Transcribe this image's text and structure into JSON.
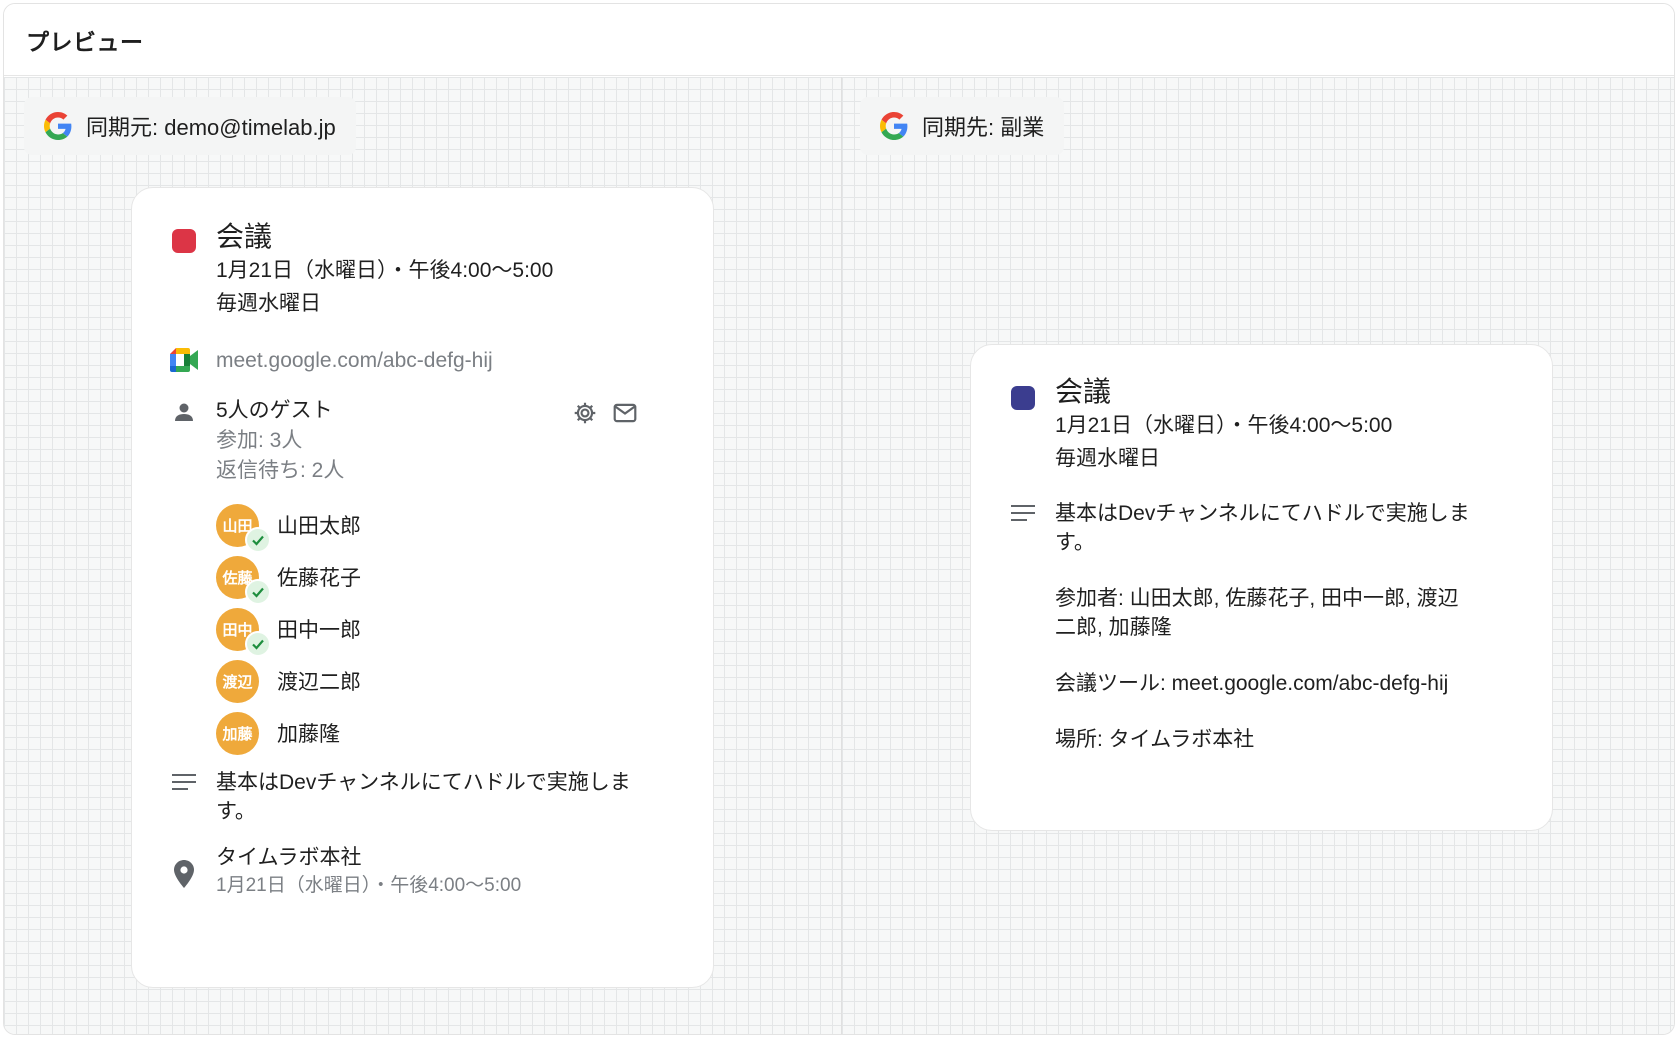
{
  "header": {
    "title": "プレビュー"
  },
  "left": {
    "chip": "同期元: demo@timelab.jp",
    "event": {
      "title": "会議",
      "color": "#dc3546",
      "datetime": "1月21日（水曜日）・午後4:00〜5:00",
      "recurrence": "毎週水曜日",
      "meet_link": "meet.google.com/abc-defg-hij",
      "guests_title": "5人のゲスト",
      "guests_joined": "参加: 3人",
      "guests_pending": "返信待ち: 2人",
      "guests": [
        {
          "initials": "山田",
          "name": "山田太郎",
          "accepted": true
        },
        {
          "initials": "佐藤",
          "name": "佐藤花子",
          "accepted": true
        },
        {
          "initials": "田中",
          "name": "田中一郎",
          "accepted": true
        },
        {
          "initials": "渡辺",
          "name": "渡辺二郎",
          "accepted": false
        },
        {
          "initials": "加藤",
          "name": "加藤隆",
          "accepted": false
        }
      ],
      "description_l1": "基本はDevチャンネルにてハドルで実施しま",
      "description_l2": "す。",
      "location": "タイムラボ本社",
      "location_time": "1月21日（水曜日）・午後4:00〜5:00"
    }
  },
  "right": {
    "chip": "同期先: 副業",
    "event": {
      "title": "会議",
      "color": "#3b3d8f",
      "datetime": "1月21日（水曜日）・午後4:00〜5:00",
      "recurrence": "毎週水曜日",
      "desc_l1": "基本はDevチャンネルにてハドルで実施しま",
      "desc_l2": "す。",
      "attendees_l1": "参加者: 山田太郎, 佐藤花子, 田中一郎, 渡辺",
      "attendees_l2": "二郎, 加藤隆",
      "tool": "会議ツール: meet.google.com/abc-defg-hij",
      "place": "場所: タイムラボ本社"
    }
  },
  "icons": {
    "google": "google-g-icon",
    "meet": "google-meet-icon",
    "person": "person-icon",
    "settings": "gear-icon",
    "mail": "mail-icon",
    "notes": "notes-lines-icon",
    "location": "location-pin-icon",
    "check": "check-icon"
  },
  "colors": {
    "avatar": "#efa93b",
    "check": "#1e8e3e"
  }
}
